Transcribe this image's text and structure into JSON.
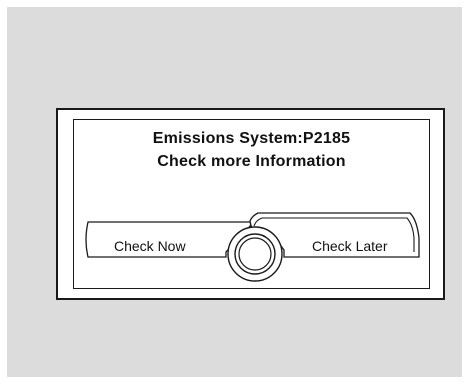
{
  "dialog": {
    "title_line1": "Emissions System:P2185",
    "title_line2": "Check more Information"
  },
  "buttons": {
    "check_now_label": "Check Now",
    "check_later_label": "Check Later"
  },
  "selected_button": "Check Later",
  "icons": {
    "center_dial": "selector-knob-icon"
  },
  "colors": {
    "panel_background": "#dcdcdc",
    "screen_background": "#ffffff",
    "line": "#1a1a1a"
  }
}
